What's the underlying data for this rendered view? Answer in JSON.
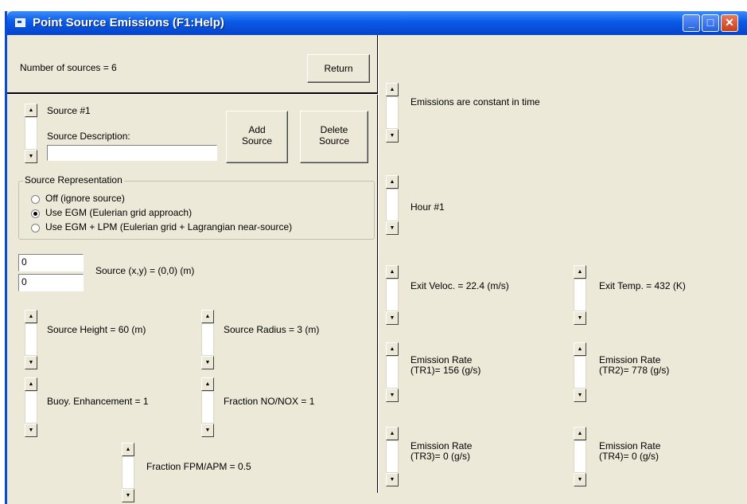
{
  "window": {
    "title": "Point Source Emissions (F1:Help)",
    "icons": {
      "app": "window-app-icon",
      "minimize": "minimize-icon",
      "maximize": "maximize-icon",
      "close": "close-icon"
    },
    "minimize_glyph": "_",
    "maximize_glyph": "□",
    "close_glyph": "✕",
    "colors": {
      "titlebar": "#0a5ae8",
      "close": "#c9401c",
      "client": "#ece9d8"
    }
  },
  "header": {
    "sources_count_label": "Number of sources = 6",
    "return_button": "Return"
  },
  "source": {
    "label": "Source #1",
    "description_label": "Source Description:",
    "description_value": "",
    "add_button_line1": "Add",
    "add_button_line2": "Source",
    "delete_button_line1": "Delete",
    "delete_button_line2": "Source"
  },
  "representation": {
    "legend": "Source Representation",
    "options": [
      {
        "label": "Off (ignore source)",
        "selected": false
      },
      {
        "label": "Use EGM (Eulerian grid approach)",
        "selected": true
      },
      {
        "label": "Use EGM + LPM (Eulerian grid + Lagrangian near-source)",
        "selected": false
      }
    ]
  },
  "location": {
    "x_value": "0",
    "y_value": "0",
    "label": "Source (x,y) = (0,0) (m)"
  },
  "parameters": {
    "height": "Source Height = 60 (m)",
    "radius": "Source Radius = 3 (m)",
    "buoy": "Buoy. Enhancement = 1",
    "no_nox": "Fraction NO/NOX = 1",
    "fpm_apm": "Fraction FPM/APM = 0.5"
  },
  "emissions": {
    "constant_label": "Emissions are constant in time",
    "hour_label": "Hour #1",
    "exit_veloc": "Exit Veloc. = 22.4 (m/s)",
    "exit_temp": "Exit Temp. = 432 (K)",
    "tr1_line1": "Emission Rate",
    "tr1_line2": "(TR1)= 156 (g/s)",
    "tr2_line1": "Emission Rate",
    "tr2_line2": "(TR2)= 778 (g/s)",
    "tr3_line1": "Emission Rate",
    "tr3_line2": "(TR3)= 0 (g/s)",
    "tr4_line1": "Emission Rate",
    "tr4_line2": "(TR4)= 0 (g/s)"
  },
  "spinner_arrows": {
    "up": "▲",
    "down": "▼"
  }
}
